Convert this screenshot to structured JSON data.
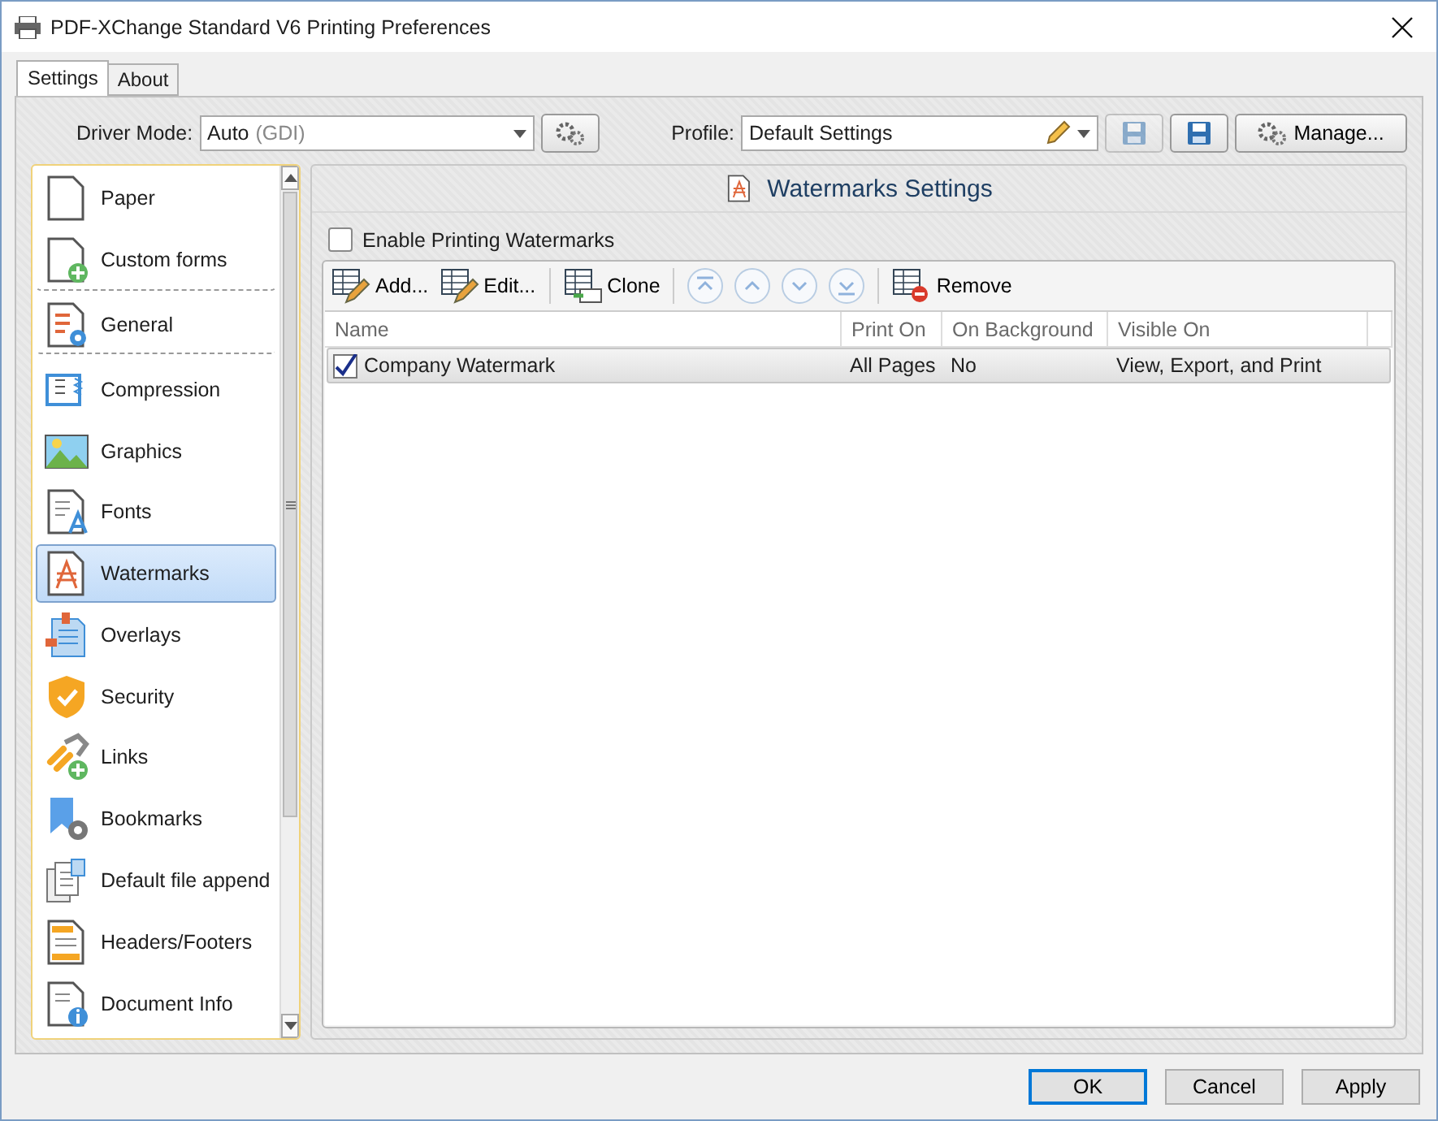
{
  "window": {
    "title": "PDF-XChange Standard V6 Printing Preferences"
  },
  "tabs": [
    {
      "label": "Settings",
      "selected": true
    },
    {
      "label": "About",
      "selected": false
    }
  ],
  "driver_mode": {
    "label": "Driver Mode:",
    "value": "Auto",
    "hint": "(GDI)"
  },
  "profile": {
    "label": "Profile:",
    "value": "Default Settings",
    "save_buttons": [
      {
        "disabled": true
      },
      {
        "disabled": false
      }
    ],
    "manage": "Manage..."
  },
  "sidebar": {
    "items": [
      {
        "label": "Paper",
        "selected": false,
        "divider_after": false
      },
      {
        "label": "Custom forms",
        "selected": false,
        "divider_after": true
      },
      {
        "label": "General",
        "selected": false,
        "divider_after": true
      },
      {
        "label": "Compression",
        "selected": false,
        "divider_after": false
      },
      {
        "label": "Graphics",
        "selected": false,
        "divider_after": false
      },
      {
        "label": "Fonts",
        "selected": false,
        "divider_after": false
      },
      {
        "label": "Watermarks",
        "selected": true,
        "divider_after": false
      },
      {
        "label": "Overlays",
        "selected": false,
        "divider_after": false
      },
      {
        "label": "Security",
        "selected": false,
        "divider_after": false
      },
      {
        "label": "Links",
        "selected": false,
        "divider_after": false
      },
      {
        "label": "Bookmarks",
        "selected": false,
        "divider_after": false
      },
      {
        "label": "Default file append",
        "selected": false,
        "divider_after": false
      },
      {
        "label": "Headers/Footers",
        "selected": false,
        "divider_after": false
      },
      {
        "label": "Document Info",
        "selected": false,
        "divider_after": false
      }
    ]
  },
  "panel": {
    "title": "Watermarks Settings",
    "enable": {
      "label": "Enable Printing Watermarks",
      "checked": false
    },
    "toolbar": [
      {
        "kind": "button",
        "label": "Add...",
        "disabled": false
      },
      {
        "kind": "button",
        "label": "Edit...",
        "disabled": false
      },
      {
        "kind": "separator"
      },
      {
        "kind": "button",
        "label": "Clone",
        "disabled": false
      },
      {
        "kind": "separator"
      },
      {
        "kind": "nav",
        "disabled": true
      },
      {
        "kind": "nav",
        "disabled": true
      },
      {
        "kind": "nav",
        "disabled": true
      },
      {
        "kind": "nav",
        "disabled": true
      },
      {
        "kind": "separator"
      },
      {
        "kind": "button",
        "label": "Remove",
        "disabled": false
      }
    ],
    "table": {
      "columns": [
        "Name",
        "Print On",
        "On Background",
        "Visible On"
      ],
      "rows": [
        {
          "checked": true,
          "selected": true,
          "cells": [
            "Company Watermark",
            "All Pages",
            "No",
            "View, Export, and Print"
          ]
        }
      ]
    }
  },
  "buttons": [
    {
      "label": "OK",
      "default": true
    },
    {
      "label": "Cancel",
      "default": false
    },
    {
      "label": "Apply",
      "default": false
    }
  ]
}
